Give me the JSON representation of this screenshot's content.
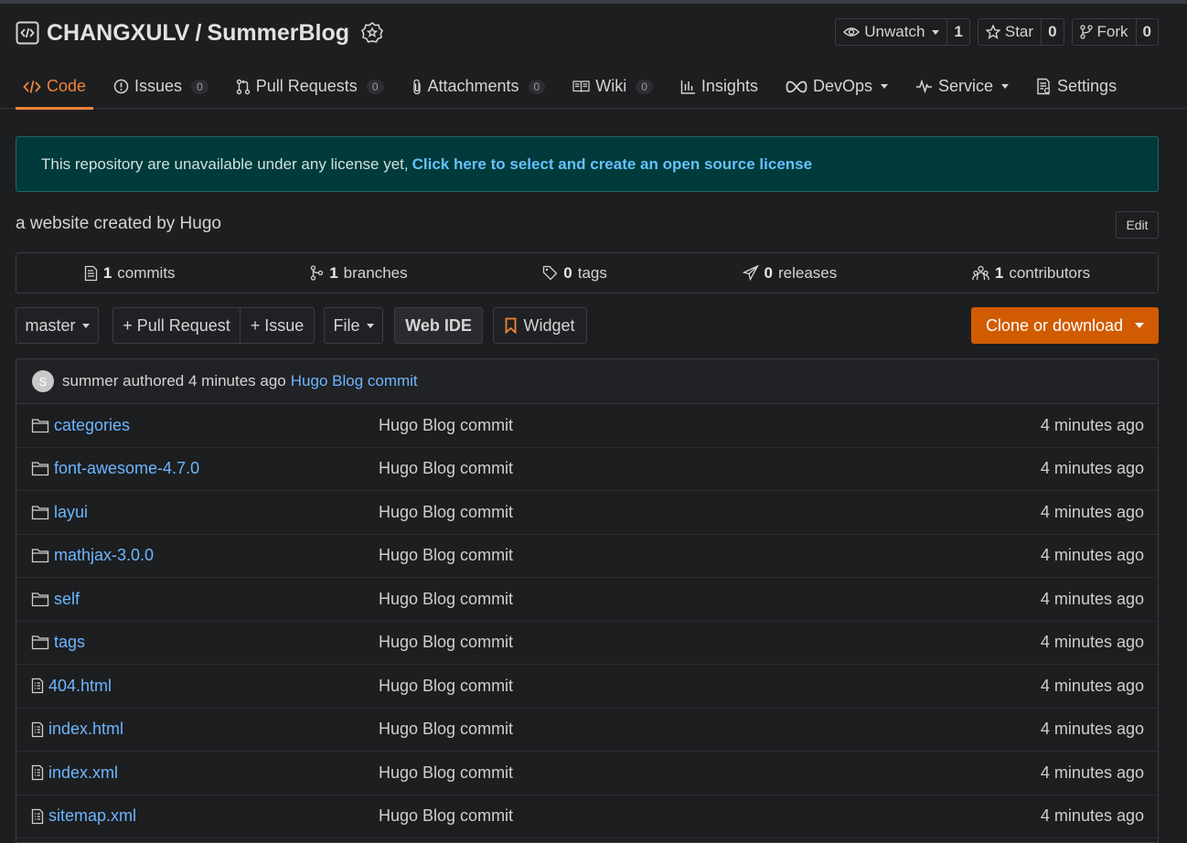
{
  "repo": {
    "owner": "CHANGXULV",
    "separator": "/",
    "name": "SummerBlog"
  },
  "actions": {
    "watch": {
      "label": "Unwatch",
      "count": "1"
    },
    "star": {
      "label": "Star",
      "count": "0"
    },
    "fork": {
      "label": "Fork",
      "count": "0"
    }
  },
  "tabs": [
    {
      "label": "Code"
    },
    {
      "label": "Issues",
      "count": "0"
    },
    {
      "label": "Pull Requests",
      "count": "0"
    },
    {
      "label": "Attachments",
      "count": "0"
    },
    {
      "label": "Wiki",
      "count": "0"
    },
    {
      "label": "Insights"
    },
    {
      "label": "DevOps"
    },
    {
      "label": "Service"
    },
    {
      "label": "Settings"
    }
  ],
  "license": {
    "text": "This repository are unavailable under any license yet,",
    "link": "Click here to select and create an open source license"
  },
  "description": "a website created by Hugo",
  "edit_label": "Edit",
  "stats": [
    {
      "count": "1",
      "label": "commits"
    },
    {
      "count": "1",
      "label": "branches"
    },
    {
      "count": "0",
      "label": "tags"
    },
    {
      "count": "0",
      "label": "releases"
    },
    {
      "count": "1",
      "label": "contributors"
    }
  ],
  "toolbar": {
    "branch": "master",
    "pull_request": "+ Pull Request",
    "issue": "+ Issue",
    "file": "File",
    "web_ide": "Web IDE",
    "widget": "Widget",
    "clone": "Clone or download"
  },
  "last_commit": {
    "avatar": "S",
    "author": "summer",
    "action": "authored 4 minutes ago",
    "message": "Hugo Blog commit"
  },
  "files": [
    {
      "name": "categories",
      "type": "folder",
      "message": "Hugo Blog commit",
      "time": "4 minutes ago"
    },
    {
      "name": "font-awesome-4.7.0",
      "type": "folder",
      "message": "Hugo Blog commit",
      "time": "4 minutes ago"
    },
    {
      "name": "layui",
      "type": "folder",
      "message": "Hugo Blog commit",
      "time": "4 minutes ago"
    },
    {
      "name": "mathjax-3.0.0",
      "type": "folder",
      "message": "Hugo Blog commit",
      "time": "4 minutes ago"
    },
    {
      "name": "self",
      "type": "folder",
      "message": "Hugo Blog commit",
      "time": "4 minutes ago"
    },
    {
      "name": "tags",
      "type": "folder",
      "message": "Hugo Blog commit",
      "time": "4 minutes ago"
    },
    {
      "name": "404.html",
      "type": "file",
      "message": "Hugo Blog commit",
      "time": "4 minutes ago"
    },
    {
      "name": "index.html",
      "type": "file",
      "message": "Hugo Blog commit",
      "time": "4 minutes ago"
    },
    {
      "name": "index.xml",
      "type": "file",
      "message": "Hugo Blog commit",
      "time": "4 minutes ago"
    },
    {
      "name": "sitemap.xml",
      "type": "file",
      "message": "Hugo Blog commit",
      "time": "4 minutes ago"
    }
  ],
  "colors": {
    "accent": "#f0833a",
    "clone_button": "#d15b00",
    "link": "#6cb6ff",
    "license_bg": "#003a3a",
    "background": "#1d1e20"
  }
}
